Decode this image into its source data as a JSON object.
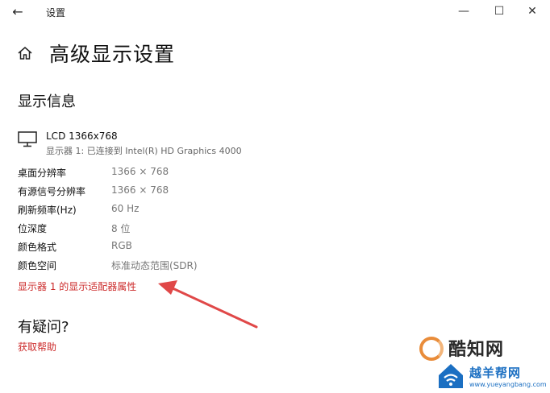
{
  "window": {
    "title": "设置",
    "back_icon": "←",
    "minimize_icon": "—",
    "maximize_icon": "☐",
    "close_icon": "✕"
  },
  "page": {
    "title": "高级显示设置"
  },
  "display_info": {
    "section_title": "显示信息",
    "display_name": "LCD 1366x768",
    "display_desc": "显示器 1: 已连接到 Intel(R) HD Graphics 4000",
    "rows": [
      {
        "label": "桌面分辨率",
        "value": "1366 × 768"
      },
      {
        "label": "有源信号分辨率",
        "value": "1366 × 768"
      },
      {
        "label": "刷新频率(Hz)",
        "value": "60 Hz"
      },
      {
        "label": "位深度",
        "value": "8 位"
      },
      {
        "label": "颜色格式",
        "value": "RGB"
      },
      {
        "label": "颜色空间",
        "value": "标准动态范围(SDR)"
      }
    ],
    "adapter_link": "显示器 1 的显示适配器属性"
  },
  "help": {
    "title": "有疑问?",
    "link": "获取帮助"
  },
  "watermarks": {
    "brand1": "酷知网",
    "brand2": "越羊帮网",
    "url": "www.yueyangbang.com"
  },
  "colors": {
    "link": "#cc2a2a",
    "arrow": "#e04848",
    "watermark_blue": "#1b6fc2",
    "watermark_orange": "#e98c3a"
  }
}
